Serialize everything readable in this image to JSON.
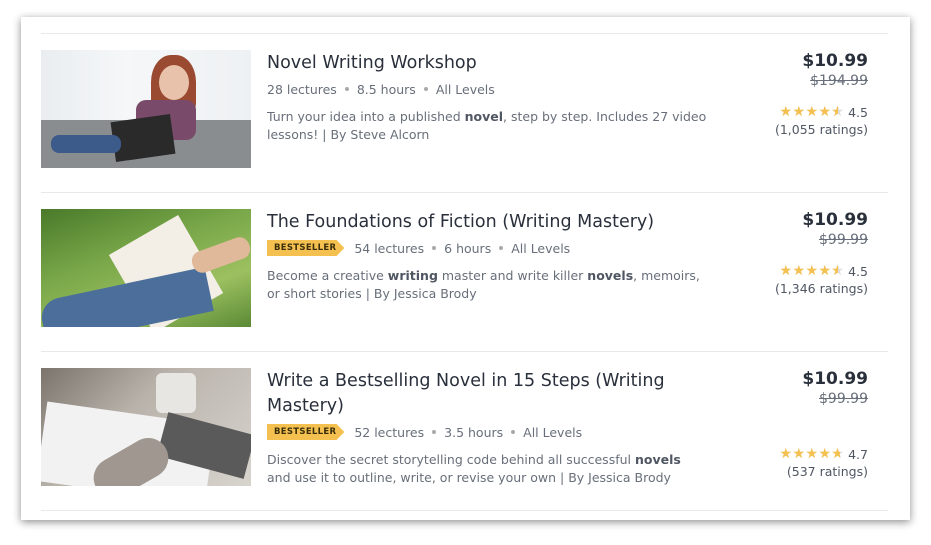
{
  "courses": [
    {
      "title": "Novel Writing Workshop",
      "bestseller": false,
      "lectures": "28 lectures",
      "hours": "8.5 hours",
      "level": "All Levels",
      "desc": [
        {
          "t": "Turn your idea into a published "
        },
        {
          "b": "novel"
        },
        {
          "t": ", step by step. Includes 27 video lessons! | By Steve Alcorn"
        }
      ],
      "price": "$10.99",
      "original_price": "$194.99",
      "rating": 4.5,
      "rating_label": "4.5",
      "ratings_count": "(1,055 ratings)"
    },
    {
      "title": "The Foundations of Fiction (Writing Mastery)",
      "bestseller": true,
      "badge": "BESTSELLER",
      "lectures": "54 lectures",
      "hours": "6 hours",
      "level": "All Levels",
      "desc": [
        {
          "t": "Become a creative "
        },
        {
          "b": "writing"
        },
        {
          "t": " master and write killer "
        },
        {
          "b": "novels"
        },
        {
          "t": ", memoirs, or short stories | By Jessica Brody"
        }
      ],
      "price": "$10.99",
      "original_price": "$99.99",
      "rating": 4.5,
      "rating_label": "4.5",
      "ratings_count": "(1,346 ratings)"
    },
    {
      "title": "Write a Bestselling Novel in 15 Steps (Writing Mastery)",
      "bestseller": true,
      "badge": "BESTSELLER",
      "lectures": "52 lectures",
      "hours": "3.5 hours",
      "level": "All Levels",
      "desc": [
        {
          "t": "Discover the secret storytelling code behind all successful "
        },
        {
          "b": "novels"
        },
        {
          "t": " and use it to outline, write, or revise your own | By Jessica Brody"
        }
      ],
      "price": "$10.99",
      "original_price": "$99.99",
      "rating": 4.7,
      "rating_label": "4.7",
      "ratings_count": "(537 ratings)"
    }
  ],
  "colors": {
    "star": "#f4c150",
    "badge": "#f4c150",
    "title": "#29303b",
    "muted": "#686f7a"
  }
}
